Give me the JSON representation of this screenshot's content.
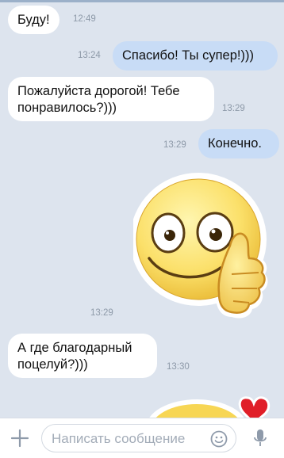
{
  "messages": [
    {
      "text": "Буду!",
      "time": "12:49",
      "direction": "in"
    },
    {
      "text": "Спасибо! Ты супер!)))",
      "time": "13:24",
      "direction": "out"
    },
    {
      "text_line1": "Пожалуйста дорогой! Тебе",
      "text_line2": "понравилось?)))",
      "time": "13:29",
      "direction": "in"
    },
    {
      "text": "Конечно.",
      "time": "13:29",
      "direction": "out"
    },
    {
      "sticker": "thumbs-up-smiley-sticker",
      "time": "13:29",
      "direction": "in"
    },
    {
      "text_line1": "А где благодарный",
      "text_line2": "поцелуй?)))",
      "time": "13:30",
      "direction": "in"
    },
    {
      "sticker": "heart-smiley-sticker",
      "direction": "in"
    }
  ],
  "composer": {
    "placeholder": "Написать сообщение",
    "attach_icon": "plus-icon",
    "emoji_icon": "smile-icon",
    "voice_icon": "microphone-icon"
  },
  "colors": {
    "background": "#dde4ee",
    "incoming_bubble": "#ffffff",
    "outgoing_bubble": "#c8dcf6",
    "time_text": "#8d99a8"
  }
}
